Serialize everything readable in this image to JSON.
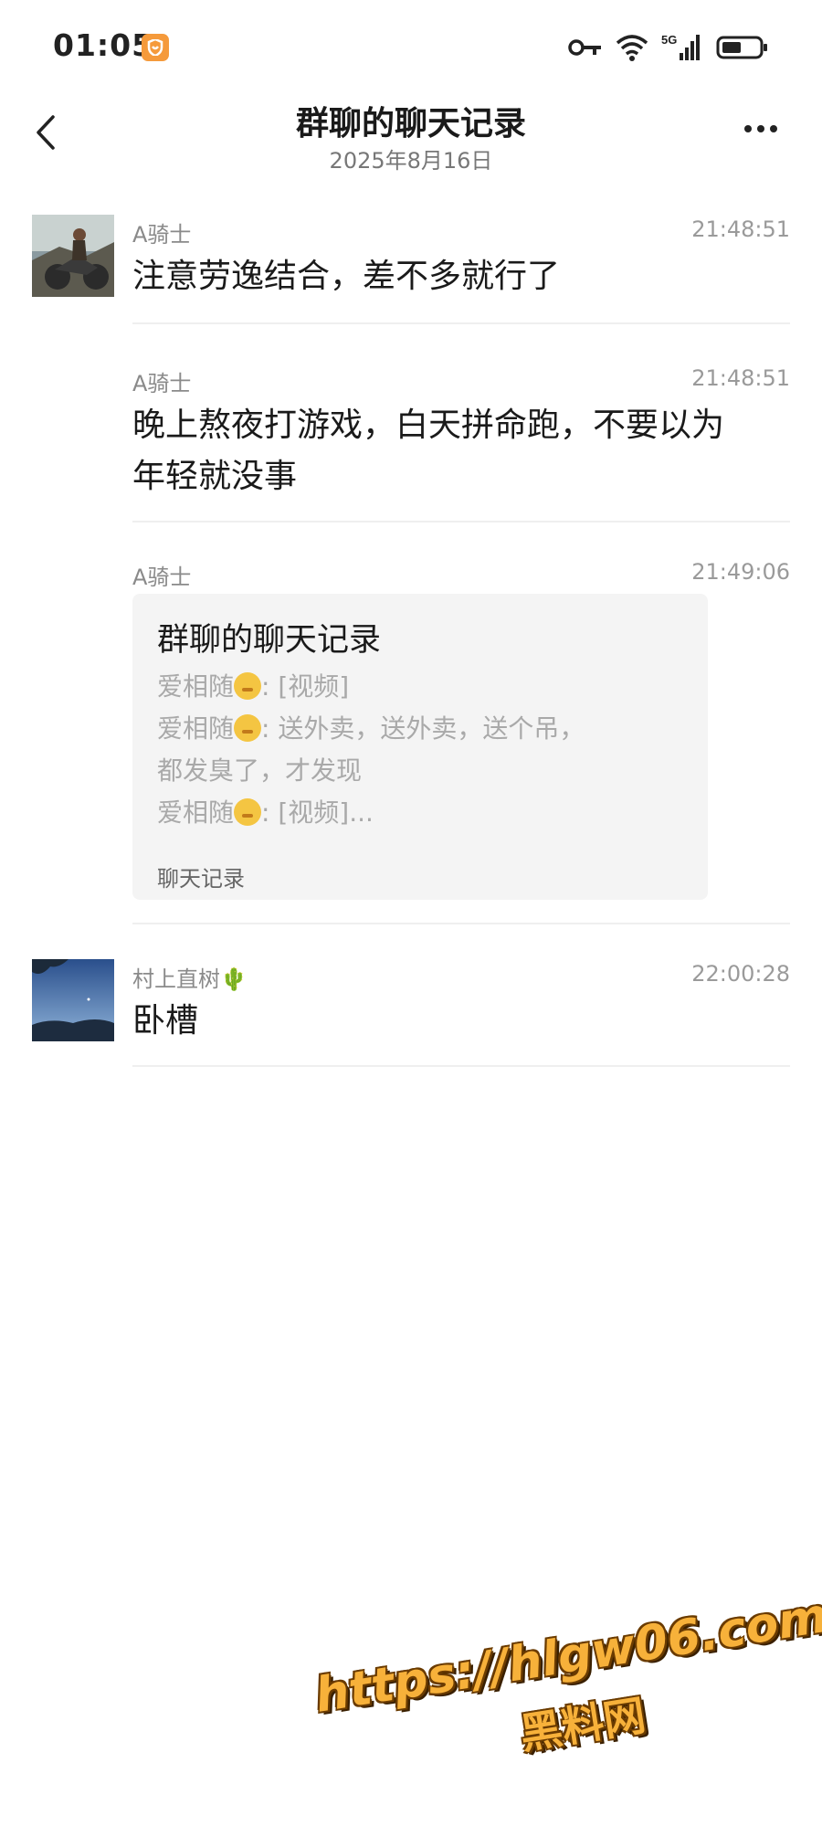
{
  "status_bar": {
    "time": "01:05",
    "network": "5G",
    "icons": [
      "app-shield-icon",
      "key-icon",
      "wifi-icon",
      "signal-icon",
      "battery-icon"
    ]
  },
  "nav": {
    "title": "群聊的聊天记录",
    "subtitle": "2025年8月16日",
    "back_icon": "chevron-left-icon",
    "more_icon": "more-dots-icon"
  },
  "messages": [
    {
      "sender": "A骑士",
      "time": "21:48:51",
      "text": "注意劳逸结合，差不多就行了"
    },
    {
      "sender": "A骑士",
      "time": "21:48:51",
      "text_line1": "晚上熬夜打游戏，白天拼命跑，不要以为",
      "text_line2": "年轻就没事"
    },
    {
      "sender": "A骑士",
      "time": "21:49:06",
      "card": {
        "title": "群聊的聊天记录",
        "lines": [
          {
            "name": "爱相随",
            "content": ": [视频]"
          },
          {
            "name": "爱相随",
            "content": ": 送外卖，送外卖，送个吊，"
          },
          {
            "name": "",
            "content": "都发臭了，才发现"
          },
          {
            "name": "爱相随",
            "content": ": [视频]..."
          }
        ],
        "footer": "聊天记录"
      }
    },
    {
      "sender": "村上直树🌵",
      "time": "22:00:28",
      "text": "卧槽"
    }
  ],
  "watermark": {
    "url": "https://hlgw06.com",
    "name": "黑料网"
  },
  "colors": {
    "background": "#ffffff",
    "card_bg": "#f4f4f4",
    "muted_text": "#8a8a8a",
    "watermark": "#f7b13a"
  }
}
